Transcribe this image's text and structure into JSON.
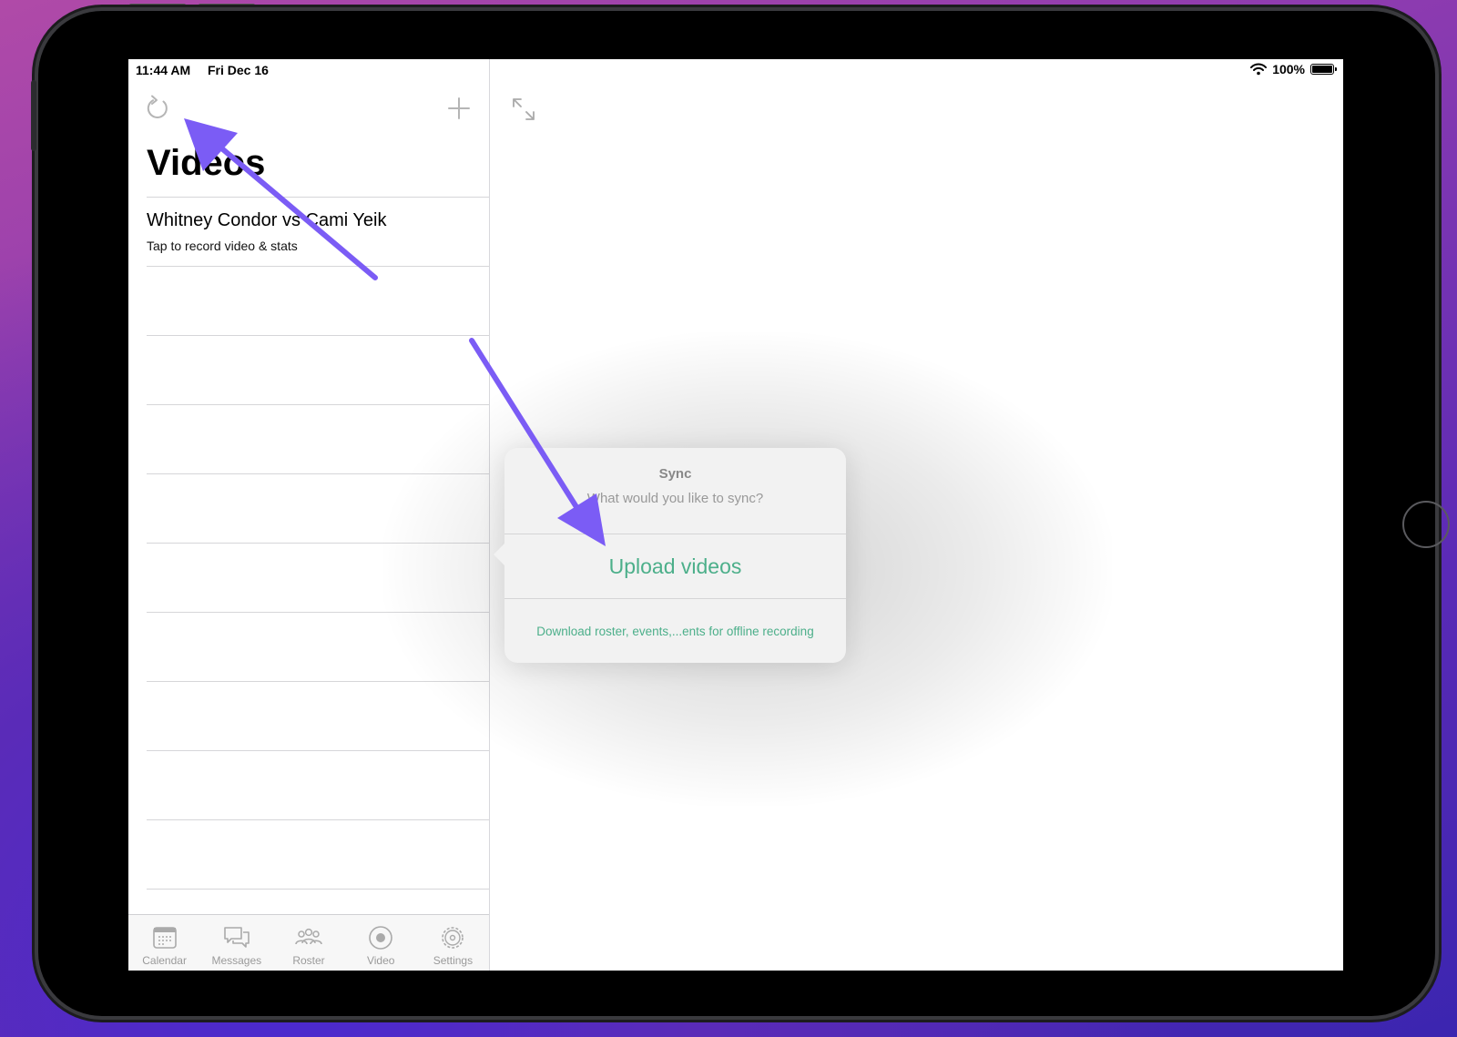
{
  "status_bar": {
    "time": "11:44 AM",
    "date": "Fri Dec 16",
    "battery": "100%"
  },
  "master": {
    "title": "Videos",
    "items": [
      {
        "title": "Whitney Condor vs Cami Yeik",
        "subtitle": "Tap to record video & stats"
      }
    ]
  },
  "tabs": [
    {
      "label": "Calendar",
      "icon": "calendar-icon"
    },
    {
      "label": "Messages",
      "icon": "messages-icon"
    },
    {
      "label": "Roster",
      "icon": "roster-icon"
    },
    {
      "label": "Video",
      "icon": "video-icon"
    },
    {
      "label": "Settings",
      "icon": "settings-icon"
    }
  ],
  "popover": {
    "title": "Sync",
    "message": "What would you like to sync?",
    "upload_label": "Upload videos",
    "download_label": "Download roster, events,...ents for offline recording"
  },
  "colors": {
    "accent": "#4caf8a",
    "annotation_arrow": "#7b5cf5"
  }
}
